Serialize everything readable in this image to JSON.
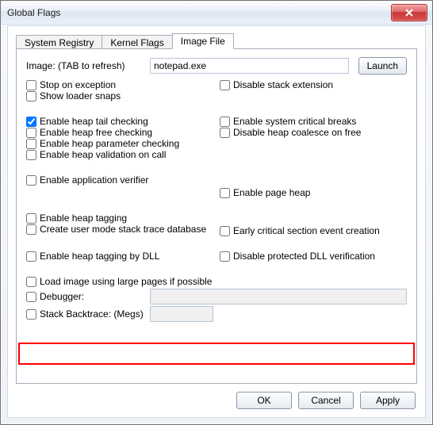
{
  "window": {
    "title": "Global Flags"
  },
  "tabs": {
    "system_registry": "System Registry",
    "kernel_flags": "Kernel Flags",
    "image_file": "Image File"
  },
  "image_row": {
    "label": "Image: (TAB to refresh)",
    "value": "notepad.exe",
    "launch": "Launch"
  },
  "checks": {
    "stop_on_exception": "Stop on exception",
    "show_loader_snaps": "Show loader snaps",
    "disable_stack_extension": "Disable stack extension",
    "enable_heap_tail": "Enable heap tail checking",
    "enable_heap_free": "Enable heap free checking",
    "enable_heap_param": "Enable heap parameter checking",
    "enable_heap_valid_call": "Enable heap validation on call",
    "enable_sys_crit_breaks": "Enable system critical breaks",
    "disable_heap_coalesce": "Disable heap coalesce on free",
    "enable_app_verifier": "Enable application verifier",
    "enable_page_heap": "Enable page heap",
    "enable_heap_tagging": "Enable heap tagging",
    "create_umst_db": "Create user mode stack trace database",
    "early_crit_section": "Early critical section event creation",
    "enable_heap_tag_dll": "Enable heap tagging by DLL",
    "disable_protected_dll": "Disable protected DLL verification",
    "load_large_pages": "Load image using large pages if possible",
    "debugger": "Debugger:",
    "stack_backtrace": "Stack Backtrace: (Megs)"
  },
  "buttons": {
    "ok": "OK",
    "cancel": "Cancel",
    "apply": "Apply"
  }
}
